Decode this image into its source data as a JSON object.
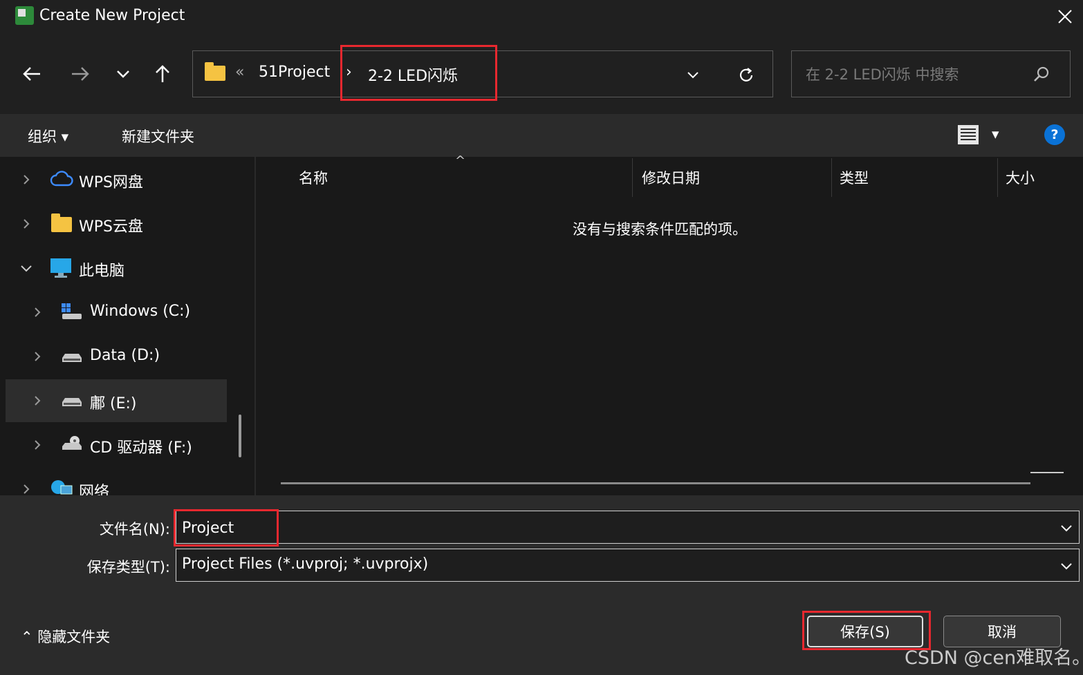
{
  "window": {
    "title": "Create New Project",
    "close_glyph": "✕"
  },
  "nav": {
    "back_glyph": "←",
    "forward_glyph": "→",
    "recent_glyph": "⌄",
    "up_glyph": "↑"
  },
  "address": {
    "overflow": "«",
    "crumbs": [
      "51Project",
      "2-2 LED闪烁"
    ],
    "separator": "›",
    "dropdown_glyph": "⌄",
    "refresh_glyph": "↻"
  },
  "search": {
    "placeholder": "在 2-2 LED闪烁 中搜索",
    "icon_glyph": "⚲"
  },
  "toolbar": {
    "organize": "组织 ▾",
    "new_folder": "新建文件夹",
    "view_menu_glyph": "▾",
    "help_glyph": "?"
  },
  "sidebar": {
    "items": [
      {
        "label": "WPS网盘",
        "icon": "cloud-icon"
      },
      {
        "label": "WPS云盘",
        "icon": "folder-icon"
      },
      {
        "label": "此电脑",
        "icon": "monitor-icon"
      },
      {
        "label": "Windows (C:)",
        "icon": "windows-drive-icon"
      },
      {
        "label": "Data (D:)",
        "icon": "drive-icon"
      },
      {
        "label": "鄘 (E:)",
        "icon": "drive-icon"
      },
      {
        "label": "CD 驱动器 (F:)",
        "icon": "cd-drive-icon"
      },
      {
        "label": "网络",
        "icon": "network-icon"
      }
    ],
    "chevron_right": "›",
    "chevron_down": "⌄"
  },
  "file_list": {
    "columns": [
      "名称",
      "修改日期",
      "类型",
      "大小"
    ],
    "sort_glyph": "^",
    "empty_message": "没有与搜索条件匹配的项。"
  },
  "form": {
    "filename_label": "文件名(N):",
    "filename_value": "Project",
    "filetype_label": "保存类型(T):",
    "filetype_value": "Project Files (*.uvproj; *.uvprojx)",
    "combo_glyph": "⌄"
  },
  "footer": {
    "hide_folders": "⌃ 隐藏文件夹",
    "save_button": "保存(S)",
    "cancel_button": "取消"
  },
  "watermark": "CSDN @cen难取名。",
  "colors": {
    "highlight_red": "#e8282f",
    "help_blue": "#0a72d6",
    "folder_yellow": "#f5c342"
  }
}
